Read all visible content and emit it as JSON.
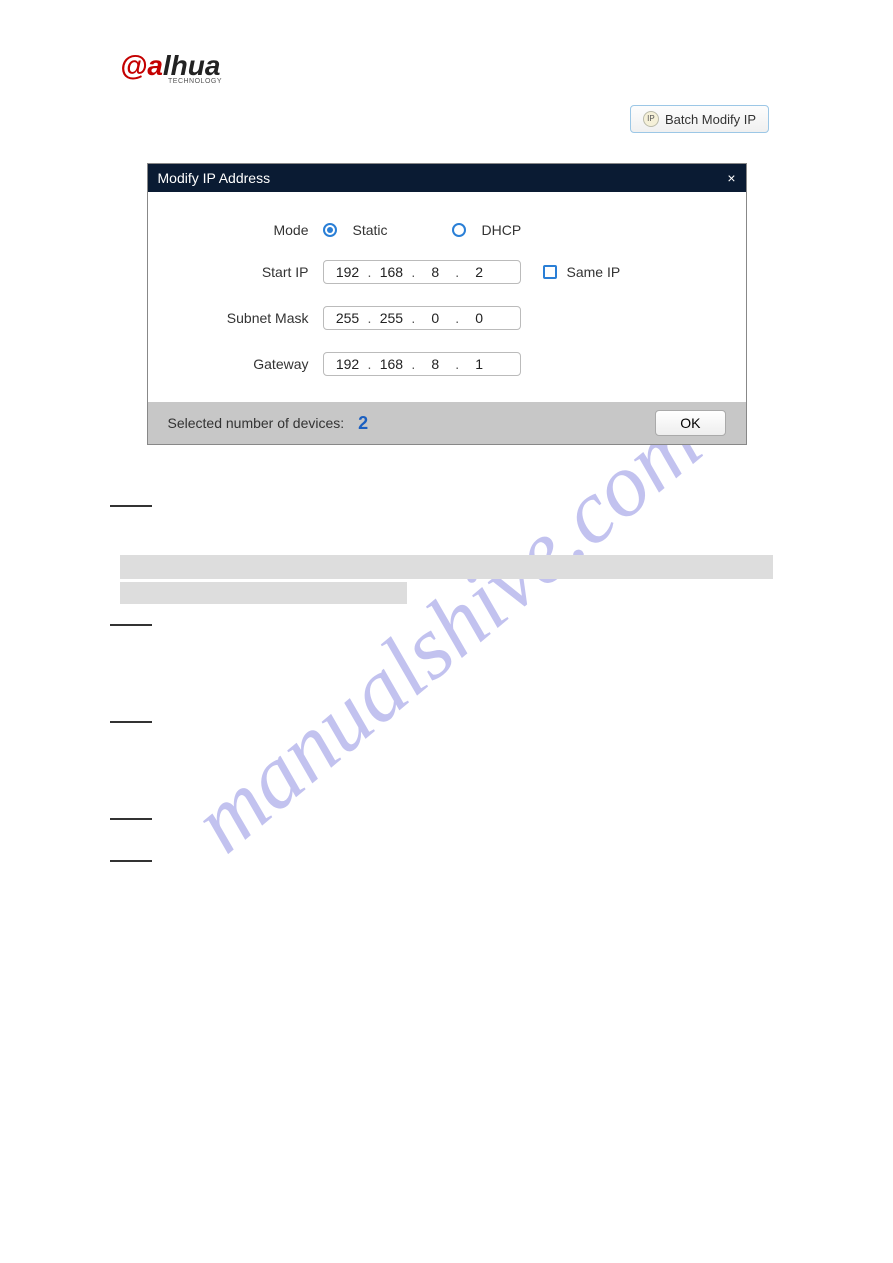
{
  "logo": {
    "at": "a",
    "lhua": "lhua",
    "sub": "TECHNOLOGY"
  },
  "batch_button": {
    "label": "Batch Modify IP",
    "icon_text": "IP"
  },
  "dialog": {
    "title": "Modify IP Address",
    "close_glyph": "×",
    "mode": {
      "label": "Mode",
      "static_label": "Static",
      "dhcp_label": "DHCP",
      "selected": "static"
    },
    "start_ip": {
      "label": "Start IP",
      "octets": [
        "192",
        "168",
        "8",
        "2"
      ],
      "same_ip_label": "Same IP"
    },
    "subnet_mask": {
      "label": "Subnet Mask",
      "octets": [
        "255",
        "255",
        "0",
        "0"
      ]
    },
    "gateway": {
      "label": "Gateway",
      "octets": [
        "192",
        "168",
        "8",
        "1"
      ]
    },
    "footer": {
      "selected_label": "Selected number of devices:",
      "count": "2",
      "ok_label": "OK"
    }
  },
  "watermark": "manualshive.com"
}
